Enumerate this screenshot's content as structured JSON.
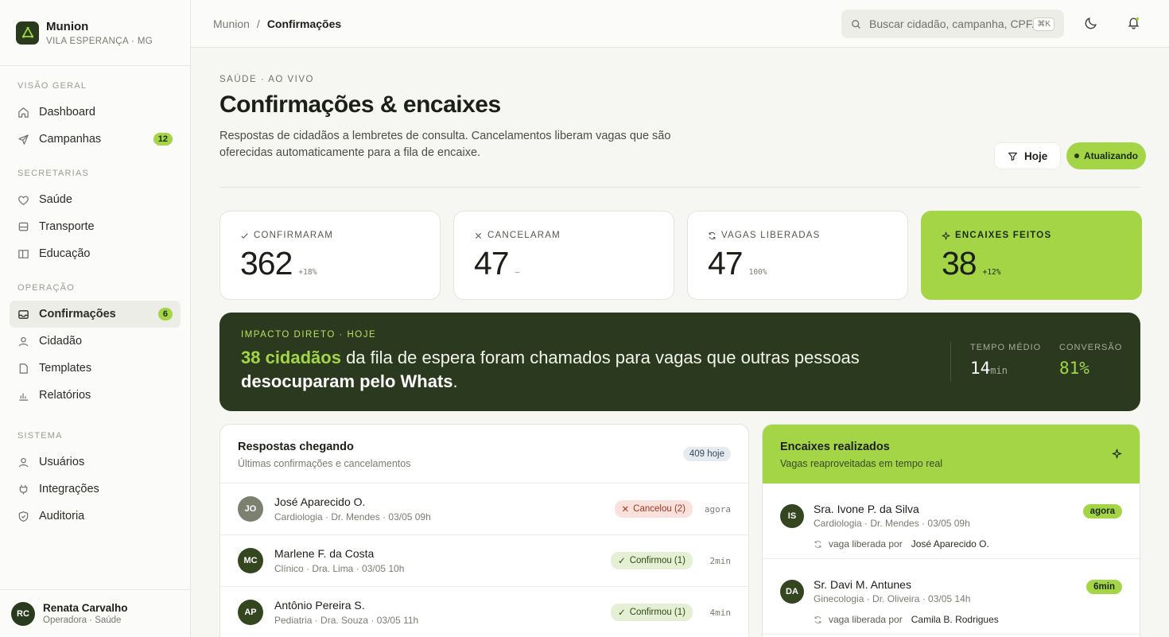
{
  "brand": {
    "name": "Munion",
    "location": "VILA ESPERANÇA · MG"
  },
  "nav": {
    "sections": [
      {
        "title": "VISÃO GERAL",
        "items": [
          {
            "label": "Dashboard",
            "icon": "home-icon"
          },
          {
            "label": "Campanhas",
            "icon": "send-icon",
            "badge": "12"
          }
        ]
      },
      {
        "title": "SECRETARIAS",
        "items": [
          {
            "label": "Saúde",
            "icon": "heart-icon"
          },
          {
            "label": "Transporte",
            "icon": "bus-icon"
          },
          {
            "label": "Educação",
            "icon": "book-icon"
          }
        ]
      },
      {
        "title": "OPERAÇÃO",
        "items": [
          {
            "label": "Confirmações",
            "icon": "inbox-icon",
            "badge": "6",
            "active": true
          },
          {
            "label": "Cidadão",
            "icon": "user-icon"
          },
          {
            "label": "Templates",
            "icon": "file-icon"
          },
          {
            "label": "Relatórios",
            "icon": "chart-icon"
          }
        ]
      },
      {
        "title": "SISTEMA",
        "items": [
          {
            "label": "Usuários",
            "icon": "user-icon"
          },
          {
            "label": "Integrações",
            "icon": "plug-icon"
          },
          {
            "label": "Auditoria",
            "icon": "shield-icon"
          }
        ]
      }
    ]
  },
  "user": {
    "initials": "RC",
    "name": "Renata Carvalho",
    "role": "Operadora · Saúde"
  },
  "topbar": {
    "breadcrumb_root": "Munion",
    "breadcrumb_sep": "/",
    "breadcrumb_current": "Confirmações",
    "search_placeholder": "Buscar cidadão, campanha, CPF...",
    "search_shortcut": "⌘K"
  },
  "header": {
    "eyebrow": "SAÚDE · AO VIVO",
    "title": "Confirmações & encaixes",
    "description": "Respostas de cidadãos a lembretes de consulta. Cancelamentos liberam vagas que são oferecidas automaticamente para a fila de encaixe.",
    "filter_label": "Hoje",
    "live_label": "Atualizando"
  },
  "stats": [
    {
      "label": "CONFIRMARAM",
      "icon": "check-icon",
      "value": "362",
      "delta": "+18%"
    },
    {
      "label": "CANCELARAM",
      "icon": "x-icon",
      "value": "47",
      "delta": "—"
    },
    {
      "label": "VAGAS LIBERADAS",
      "icon": "refresh-icon",
      "value": "47",
      "delta": "100%"
    },
    {
      "label": "ENCAIXES FEITOS",
      "icon": "sparkle-icon",
      "value": "38",
      "delta": "+12%"
    }
  ],
  "impact": {
    "eyebrow": "IMPACTO DIRETO · HOJE",
    "highlight": "38 cidadãos",
    "text_mid": " da fila de espera foram chamados para vagas que outras pessoas ",
    "text_bold": "desocuparam pelo Whats",
    "text_end": ".",
    "metric1_label": "TEMPO MÉDIO",
    "metric1_value": "14",
    "metric1_unit": "min",
    "metric2_label": "CONVERSÃO",
    "metric2_value": "81%"
  },
  "responses": {
    "title": "Respostas chegando",
    "subtitle": "Últimas confirmações e cancelamentos",
    "count": "409 hoje",
    "rows": [
      {
        "initials": "JO",
        "name": "José Aparecido O.",
        "meta": "Cardiologia · Dr. Mendes · 03/05 09h",
        "status": "Cancelou (2)",
        "kind": "cancel",
        "time": "agora",
        "avatar_color": "#7b8070"
      },
      {
        "initials": "MC",
        "name": "Marlene F. da Costa",
        "meta": "Clínico · Dra. Lima · 03/05 10h",
        "status": "Confirmou (1)",
        "kind": "ok",
        "time": "2min",
        "avatar_color": "#34461f"
      },
      {
        "initials": "AP",
        "name": "Antônio Pereira S.",
        "meta": "Pediatria · Dra. Souza · 03/05 11h",
        "status": "Confirmou (1)",
        "kind": "ok",
        "time": "4min",
        "avatar_color": "#34461f"
      }
    ]
  },
  "encaixes": {
    "title": "Encaixes realizados",
    "subtitle": "Vagas reaproveitadas em tempo real",
    "via_label": "vaga liberada por",
    "rows": [
      {
        "initials": "IS",
        "name": "Sra. Ivone P. da Silva",
        "meta": "Cardiologia · Dr. Mendes · 03/05 09h",
        "via": "José Aparecido O.",
        "time": "agora"
      },
      {
        "initials": "DA",
        "name": "Sr. Davi M. Antunes",
        "meta": "Ginecologia · Dr. Oliveira · 03/05 14h",
        "via": "Camila B. Rodrigues",
        "time": "6min"
      }
    ]
  }
}
